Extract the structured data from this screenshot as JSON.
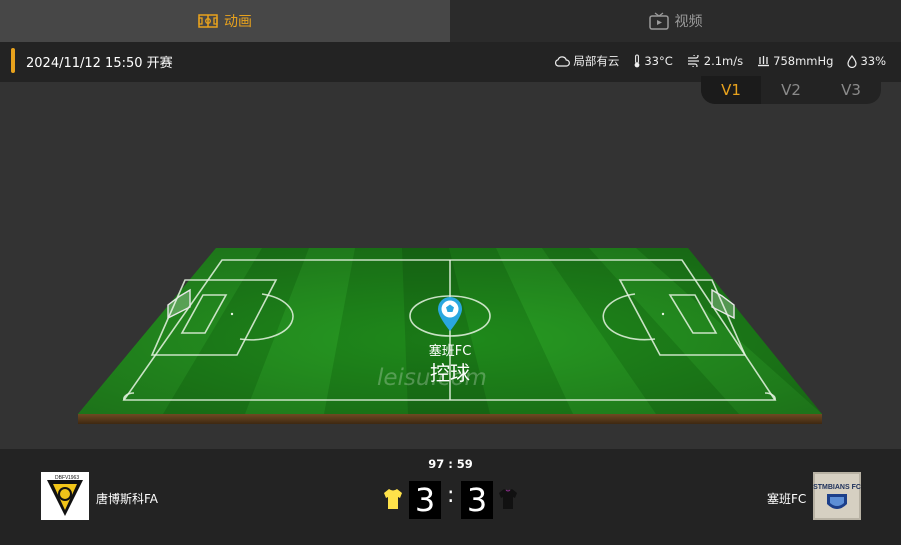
{
  "tabs": [
    {
      "label": "动画",
      "icon": "pitch-icon",
      "active": true
    },
    {
      "label": "视频",
      "icon": "tv-icon",
      "active": false
    }
  ],
  "match_info": {
    "datetime": "2024/11/12 15:50 开赛",
    "weather": [
      {
        "icon": "cloud-icon",
        "value": "局部有云"
      },
      {
        "icon": "thermometer-icon",
        "value": "33°C"
      },
      {
        "icon": "wind-icon",
        "value": "2.1m/s"
      },
      {
        "icon": "pressure-icon",
        "value": "758mmHg"
      },
      {
        "icon": "humidity-icon",
        "value": "33%"
      }
    ]
  },
  "view_switch": {
    "options": [
      "V1",
      "V2",
      "V3"
    ],
    "selected": "V1"
  },
  "field": {
    "possession_team": "塞班FC",
    "possession_status": "控球",
    "watermark": "leisu.com"
  },
  "scoreboard": {
    "time": "97 : 59",
    "home": {
      "name": "唐博斯科FA",
      "score": "3",
      "badge_text": [
        "DBFV",
        "1963"
      ]
    },
    "away": {
      "name": "塞班FC",
      "score": "3",
      "badge_text": "STMBIANS FC"
    },
    "colon": ":"
  },
  "colors": {
    "accent": "#e8a21d",
    "pitch_light": "#2a9a22",
    "pitch_dark": "#1d7f19",
    "home_kit": "#ffe24a",
    "away_kit": "#111111",
    "marker": "#2aa7e0"
  }
}
